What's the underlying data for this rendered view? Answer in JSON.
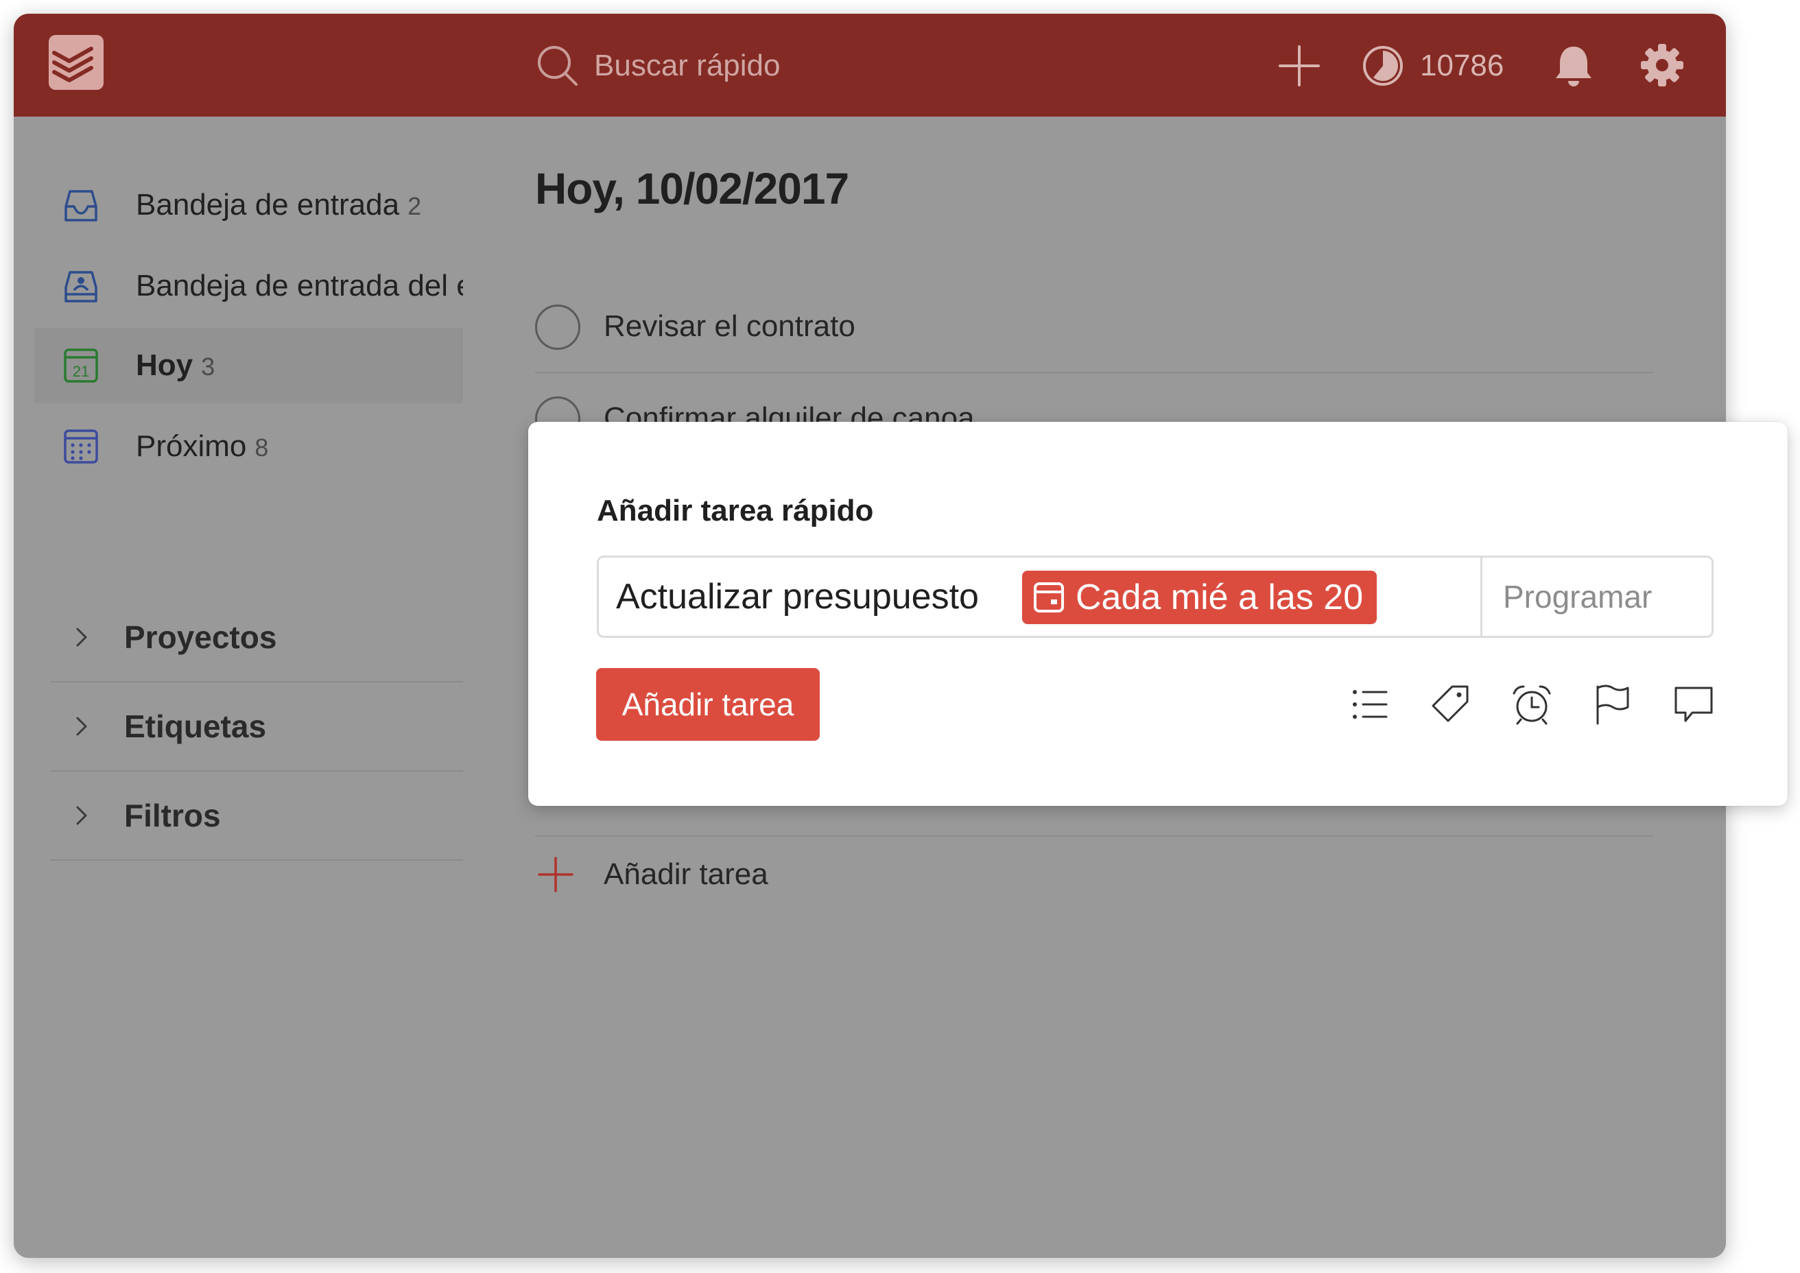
{
  "header": {
    "search_placeholder": "Buscar rápido",
    "karma_value": "10786",
    "accent_color": "#842a24"
  },
  "sidebar": {
    "items": [
      {
        "icon": "inbox-icon",
        "label": "Bandeja de entrada",
        "count": "2"
      },
      {
        "icon": "team-inbox-icon",
        "label": "Bandeja de entrada del equipo",
        "count": ""
      },
      {
        "icon": "calendar-today-icon",
        "label": "Hoy",
        "count": "3",
        "icon_text": "21"
      },
      {
        "icon": "calendar-upcoming-icon",
        "label": "Próximo",
        "count": "8"
      }
    ],
    "sections": [
      {
        "label": "Proyectos"
      },
      {
        "label": "Etiquetas"
      },
      {
        "label": "Filtros"
      }
    ]
  },
  "main": {
    "title": "Hoy, 10/02/2017",
    "tasks": [
      {
        "text": "Revisar el contrato"
      },
      {
        "text": "Confirmar alquiler de canoa"
      }
    ],
    "add_task_label": "Añadir tarea"
  },
  "quick_add": {
    "title": "Añadir tarea rápido",
    "task_text": "Actualizar presupuesto",
    "date_chip": "Cada mié a las 20",
    "schedule_placeholder": "Programar",
    "submit_label": "Añadir tarea",
    "action_icons": [
      "list-icon",
      "label-icon",
      "alarm-icon",
      "flag-icon",
      "comment-icon"
    ],
    "button_color": "#db4c3f"
  }
}
